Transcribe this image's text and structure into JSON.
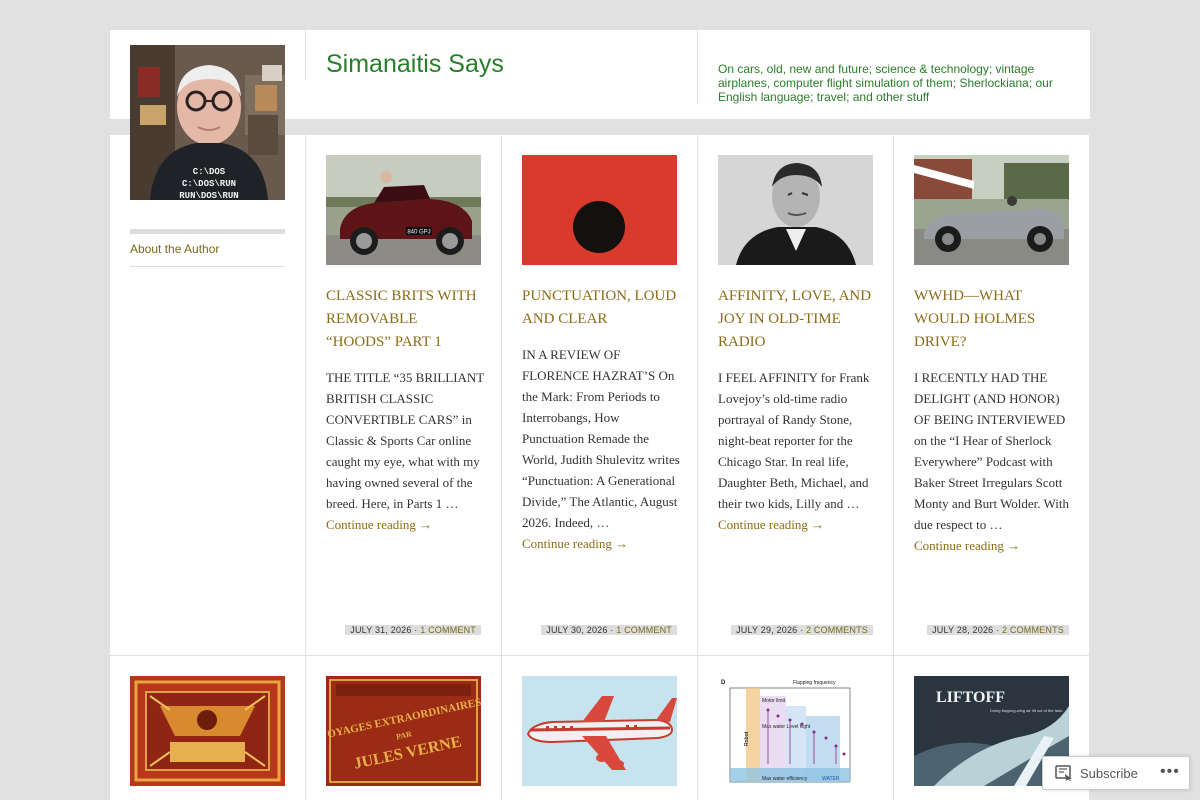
{
  "header": {
    "site_title": "Simanaitis Says",
    "tagline": "On cars, old, new and future; science & technology; vintage airplanes, computer flight simulation of them; Sherlockiana; our English language; travel; and other stuff"
  },
  "sidebar": {
    "avatar_shirt": [
      "C:\\DOS",
      "C:\\DOS\\RUN",
      "RUN\\DOS\\RUN"
    ],
    "about_link": "About the Author"
  },
  "posts": [
    {
      "title": "Classic Brits With Removable “Hoods”  Part 1",
      "excerpt": "THE TITLE “35 BRILLIANT BRITISH CLASSIC CONVERTIBLE CARS” in Classic & Sports Car online caught my eye, what with my having owned several of the breed. Here, in Parts 1 …",
      "more": "Continue reading →",
      "date": "JULY 31, 2026",
      "sep": " · ",
      "comments": "1 COMMENT",
      "plate": "840 GPJ"
    },
    {
      "title": "Punctuation, Loud and Clear",
      "excerpt": "IN A REVIEW OF FLORENCE HAZRAT’S On the Mark: From Periods to Interrobangs, How Punctuation Remade the World, Judith Shulevitz writes “Punctuation: A Generational Divide,” The Atlantic, August 2026. Indeed, …",
      "more": "Continue reading →",
      "date": "JULY 30, 2026",
      "sep": " · ",
      "comments": "1 COMMENT"
    },
    {
      "title": "Affinity, Love, and Joy in Old-Time Radio",
      "excerpt": "I FEEL AFFINITY for Frank Lovejoy’s old-time radio portrayal of Randy Stone, night-beat reporter for the Chicago Star. In real life, Daughter Beth, Michael, and their two kids, Lilly and …",
      "more": "Continue reading →",
      "date": "JULY 29, 2026",
      "sep": " · ",
      "comments": "2 COMMENTS"
    },
    {
      "title": "WWHD—What Would Holmes Drive?",
      "excerpt": "I RECENTLY HAD THE DELIGHT (AND HONOR) OF BEING INTERVIEWED on the “I Hear of Sherlock Everywhere” Podcast with Baker Street Irregulars Scott Monty and Burt Wolder. With due respect to …",
      "more": "Continue reading →",
      "date": "JULY 28, 2026",
      "sep": " · ",
      "comments": "2 COMMENTS"
    }
  ],
  "row2": {
    "book_lines": [
      "VOYAGES EXTRAORDINAIRES",
      "PAR",
      "JULES VERNE"
    ],
    "chart_title": "Flapping frequency",
    "chart_letter": "D",
    "chart_labels": [
      "Motor limit",
      "Max water Level flight",
      "Max water efficiency",
      "WATER",
      "Robot"
    ],
    "liftoff_title": "LIFTOFF",
    "liftoff_sub": "Doing flapping-wing air lift out of the tank..."
  },
  "subscribe": {
    "label": "Subscribe",
    "more": "•••"
  },
  "colors": {
    "background": "#e1e1e1",
    "title_green": "#2a7d2a",
    "post_gold": "#8a6b16"
  }
}
